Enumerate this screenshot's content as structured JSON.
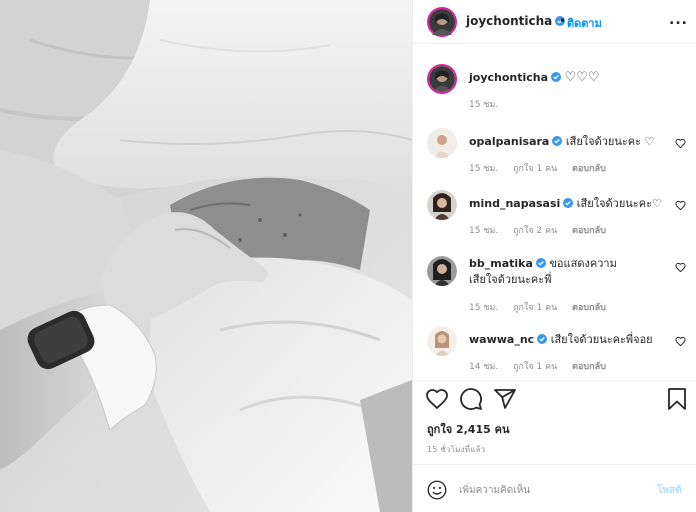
{
  "colors": {
    "accent": "#0095f6",
    "verified": "#3897f0",
    "post_disabled": "#b2dffc",
    "muted": "#8e8e8e"
  },
  "header": {
    "username": "joychonticha",
    "dot": "•",
    "follow": "ติดตาม",
    "more": "..."
  },
  "caption": {
    "username": "joychonticha",
    "text": "♡♡♡",
    "time": "15 ชม."
  },
  "comments": [
    {
      "username": "opalpanisara",
      "text": "เสียใจด้วยนะคะ ♡",
      "time": "15 ชม.",
      "likes": "ถูกใจ 1 คน",
      "reply": "ตอบกลับ"
    },
    {
      "username": "mind_napasasi",
      "text": "เสียใจด้วยนะคะ♡",
      "time": "15 ชม.",
      "likes": "ถูกใจ 2 คน",
      "reply": "ตอบกลับ"
    },
    {
      "username": "bb_matika",
      "text": "ขอแสดงความเสียใจด้วยนะคะพี่",
      "time": "15 ชม.",
      "likes": "ถูกใจ 1 คน",
      "reply": "ตอบกลับ"
    },
    {
      "username": "wawwa_nc",
      "text": "เสียใจด้วยนะคะพี่จอย",
      "time": "14 ชม.",
      "likes": "ถูกใจ 1 คน",
      "reply": "ตอบกลับ"
    }
  ],
  "icons": {
    "like": "heart-icon",
    "comment": "comment-icon",
    "share": "share-icon",
    "save": "bookmark-icon",
    "emoji": "emoji-icon",
    "comment_like": "heart-icon",
    "verified": "verified-badge-icon"
  },
  "likes_text": "ถูกใจ 2,415 คน",
  "post_time": "15 ชั่วโมงที่แล้ว",
  "add_comment": {
    "placeholder": "เพิ่มความคิดเห็น",
    "post": "โพสต์"
  }
}
